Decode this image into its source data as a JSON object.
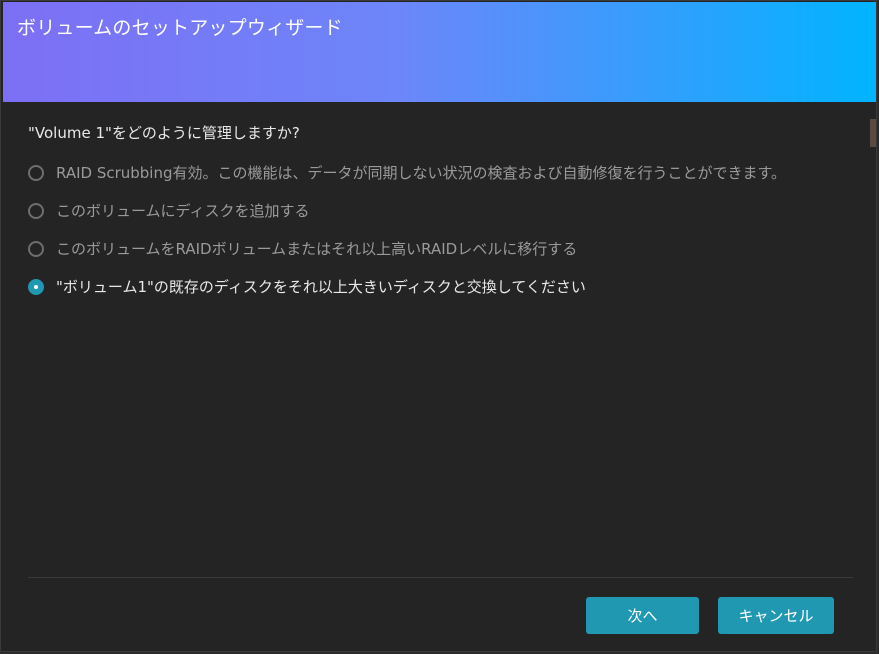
{
  "dialog": {
    "title": "ボリュームのセットアップウィザード"
  },
  "question": "\"Volume 1\"をどのように管理しますか?",
  "options": [
    {
      "label": "RAID Scrubbing有効。この機能は、データが同期しない状況の検査および自動修復を行うことができます。",
      "selected": false
    },
    {
      "label": "このボリュームにディスクを追加する",
      "selected": false
    },
    {
      "label": "このボリュームをRAIDボリュームまたはそれ以上高いRAIDレベルに移行する",
      "selected": false
    },
    {
      "label": "\"ボリューム1\"の既存のディスクをそれ以上大きいディスクと交換してください",
      "selected": true
    }
  ],
  "buttons": {
    "next": "次へ",
    "cancel": "キャンセル"
  },
  "colors": {
    "header_gradient_start": "#7d6ff5",
    "header_gradient_end": "#00b4ff",
    "accent": "#2098b2",
    "background": "#242424"
  }
}
